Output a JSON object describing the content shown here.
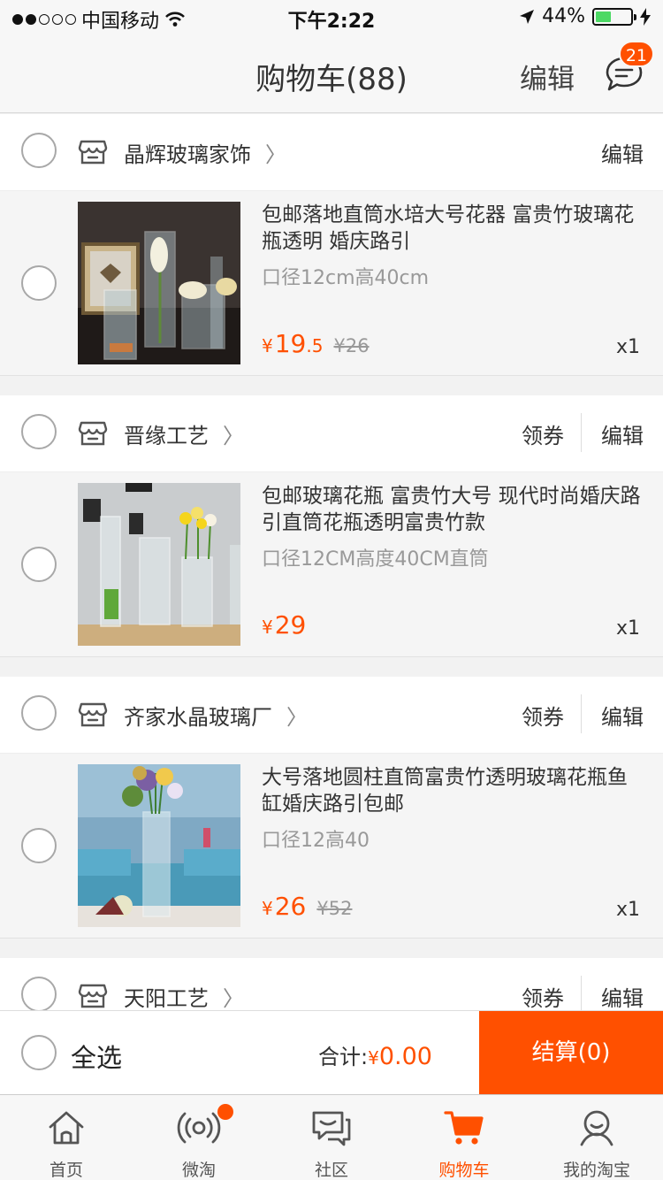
{
  "status_bar": {
    "carrier": "中国移动",
    "time": "下午2:22",
    "battery": "44%",
    "battery_level": 0.44,
    "signal_dots_on": 2,
    "signal_dots_total": 5
  },
  "nav": {
    "title": "购物车(88)",
    "edit_label": "编辑",
    "message_badge": "21"
  },
  "colors": {
    "accent": "#ff5000",
    "battery": "#4cd964"
  },
  "shops": [
    {
      "name": "晶辉玻璃家饰",
      "coupon_label": "",
      "edit_label": "编辑",
      "item": {
        "title": "包邮落地直筒水培大号花器 富贵竹玻璃花瓶透明 婚庆路引",
        "sku": "口径12cm高40cm",
        "price_yen": "¥",
        "price_int": "19",
        "price_cents": ".5",
        "original_price": "¥26",
        "qty": "x1"
      }
    },
    {
      "name": "晋缘工艺",
      "coupon_label": "领券",
      "edit_label": "编辑",
      "item": {
        "title": "包邮玻璃花瓶 富贵竹大号 现代时尚婚庆路引直筒花瓶透明富贵竹款",
        "sku": "口径12CM高度40CM直筒",
        "price_yen": "¥",
        "price_int": "29",
        "price_cents": "",
        "original_price": "",
        "qty": "x1"
      }
    },
    {
      "name": "齐家水晶玻璃厂",
      "coupon_label": "领券",
      "edit_label": "编辑",
      "item": {
        "title": "大号落地圆柱直筒富贵竹透明玻璃花瓶鱼缸婚庆路引包邮",
        "sku": "口径12高40",
        "price_yen": "¥",
        "price_int": "26",
        "price_cents": "",
        "original_price": "¥52",
        "qty": "x1"
      }
    },
    {
      "name": "天阳工艺",
      "coupon_label": "领券",
      "edit_label": "编辑"
    }
  ],
  "checkout": {
    "select_all": "全选",
    "total_label": "合计:",
    "total_yen": "¥",
    "total_amount": "0.00",
    "checkout_button": "结算(0)"
  },
  "tabs": [
    {
      "label": "首页",
      "icon": "home-icon"
    },
    {
      "label": "微淘",
      "icon": "broadcast-icon"
    },
    {
      "label": "社区",
      "icon": "community-chat-icon"
    },
    {
      "label": "购物车",
      "icon": "cart-icon",
      "active": true
    },
    {
      "label": "我的淘宝",
      "icon": "profile-icon"
    }
  ]
}
